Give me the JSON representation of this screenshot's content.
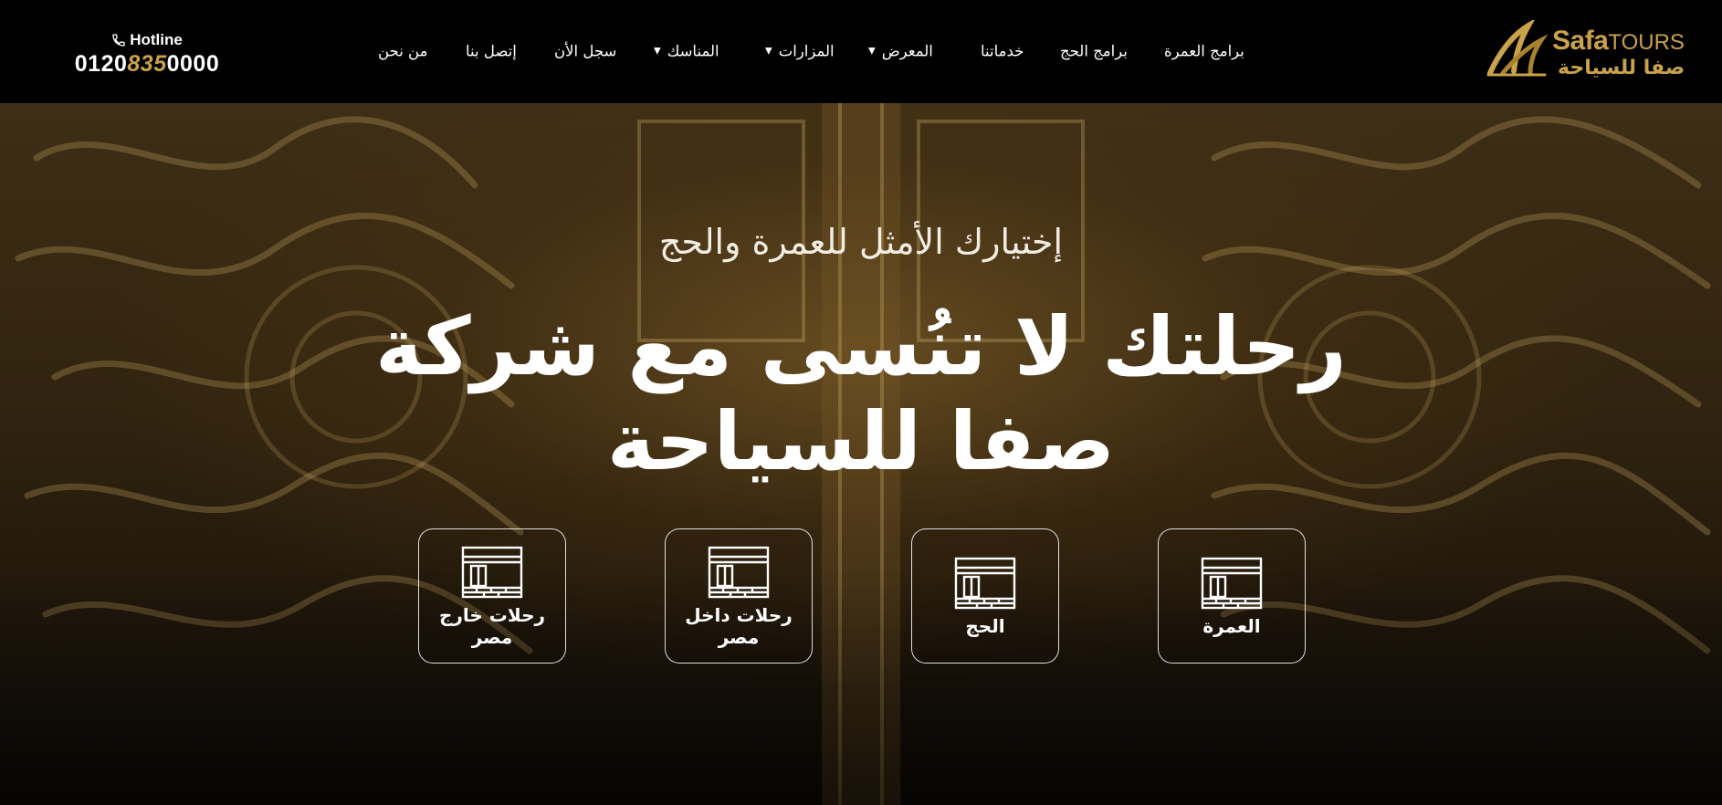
{
  "header": {
    "hotline_label": "Hotline",
    "hotline_number": {
      "prefix": "0120",
      "highlight": "835",
      "suffix": "0000"
    },
    "logo": {
      "en_safa": "Safa",
      "en_tours": "TOURS",
      "ar": "صفا للسياحة"
    },
    "nav": [
      {
        "label": "برامج العمرة",
        "has_dropdown": false
      },
      {
        "label": "برامج الحج",
        "has_dropdown": false
      },
      {
        "label": "خدماتنا",
        "has_dropdown": false
      },
      {
        "label": "المعرض",
        "has_dropdown": true
      },
      {
        "label": "المزارات",
        "has_dropdown": true
      },
      {
        "label": "المناسك",
        "has_dropdown": true
      },
      {
        "label": "سجل الأن",
        "has_dropdown": false
      },
      {
        "label": "إتصل بنا",
        "has_dropdown": false
      },
      {
        "label": "من نحن",
        "has_dropdown": false
      }
    ],
    "caret_glyph": "▼",
    "icons": [
      "phone-icon",
      "safa-logo-mark"
    ]
  },
  "hero": {
    "subtitle": "إختيارك الأمثل للعمرة والحج",
    "headline_line1": "رحلتك لا تنُسى مع شركة",
    "headline_line2": "صفا للسياحة",
    "cards": [
      {
        "label": "العمرة",
        "icon": "kaaba-icon"
      },
      {
        "label": "الحج",
        "icon": "kaaba-icon"
      },
      {
        "label": "رحلات داخل مصر",
        "icon": "kaaba-icon"
      },
      {
        "label": "رحلات خارج مصر",
        "icon": "kaaba-icon"
      }
    ]
  },
  "colors": {
    "header_bg": "#000000",
    "gold": "#c9a24a",
    "hero_tone": "#3e2e16",
    "text": "#ffffff"
  }
}
